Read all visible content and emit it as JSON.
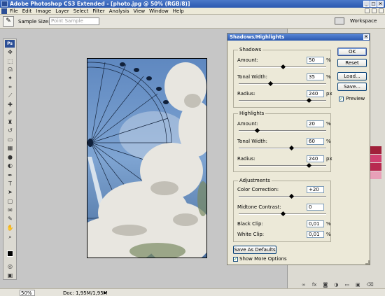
{
  "app": {
    "title": "Adobe Photoshop CS3 Extended - [photo.jpg @ 50% (RGB/8)]"
  },
  "menu": [
    "File",
    "Edit",
    "Image",
    "Layer",
    "Select",
    "Filter",
    "Analysis",
    "View",
    "Window",
    "Help"
  ],
  "options_bar": {
    "sample_size_label": "Sample Size:",
    "sample_size_value": "Point Sample",
    "workspace_label": "Workspace"
  },
  "status": {
    "zoom": "50%",
    "doc": "Doc: 1,95M/1,95M"
  },
  "dialog": {
    "title": "Shadows/Highlights",
    "shadows": {
      "legend": "Shadows",
      "amount": {
        "label": "Amount:",
        "value": "50",
        "unit": "%",
        "level": 0.5
      },
      "tonal": {
        "label": "Tonal Width:",
        "value": "35",
        "unit": "%",
        "level": 0.35
      },
      "radius": {
        "label": "Radius:",
        "value": "240",
        "unit": "px",
        "level": 0.8
      }
    },
    "highlights": {
      "legend": "Highlights",
      "amount": {
        "label": "Amount:",
        "value": "20",
        "unit": "%",
        "level": 0.2
      },
      "tonal": {
        "label": "Tonal Width:",
        "value": "60",
        "unit": "%",
        "level": 0.6
      },
      "radius": {
        "label": "Radius:",
        "value": "240",
        "unit": "px",
        "level": 0.8
      }
    },
    "adjustments": {
      "legend": "Adjustments",
      "color": {
        "label": "Color Correction:",
        "value": "+20",
        "unit": "",
        "level": 0.6
      },
      "midtone": {
        "label": "Midtone Contrast:",
        "value": "0",
        "unit": "",
        "level": 0.5
      },
      "black": {
        "label": "Black Clip:",
        "value": "0,01",
        "unit": "%"
      },
      "white": {
        "label": "White Clip:",
        "value": "0,01",
        "unit": "%"
      }
    },
    "buttons": {
      "ok": "OK",
      "reset": "Reset",
      "load": "Load...",
      "save": "Save...",
      "save_defaults": "Save As Defaults"
    },
    "preview_label": "Preview",
    "more_options_label": "Show More Options"
  },
  "colors": {
    "title_bar": "#2a58b0",
    "swatch_1": "#a0203a",
    "swatch_2": "#d04070",
    "swatch_3": "#e8a0b8"
  }
}
